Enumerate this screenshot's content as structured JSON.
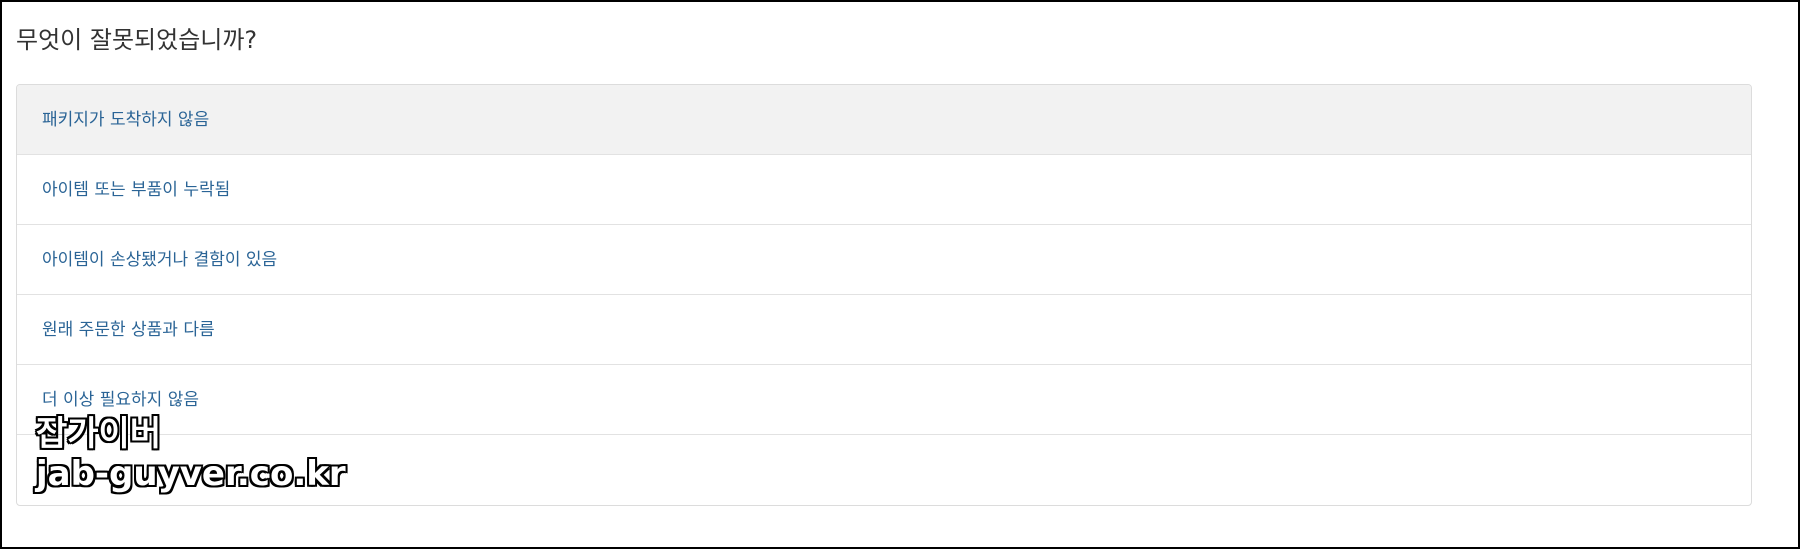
{
  "page": {
    "question": "무엇이 잘못되었습니까?"
  },
  "options": [
    {
      "label": "패키지가 도착하지 않음",
      "selected": true
    },
    {
      "label": "아이템 또는 부품이 누락됨",
      "selected": false
    },
    {
      "label": "아이템이 손상됐거나 결함이 있음",
      "selected": false
    },
    {
      "label": "원래 주문한 상품과 다름",
      "selected": false
    },
    {
      "label": "더 이상 필요하지 않음",
      "selected": false
    },
    {
      "label": "",
      "selected": false
    }
  ],
  "watermark": {
    "line1": "잡가이버",
    "line2": "jab-guyver.co.kr"
  },
  "colors": {
    "link": "#2a6496",
    "heading": "#333333",
    "selected_bg": "#f2f2f2",
    "border": "#dcdcdc",
    "frame": "#000000"
  }
}
